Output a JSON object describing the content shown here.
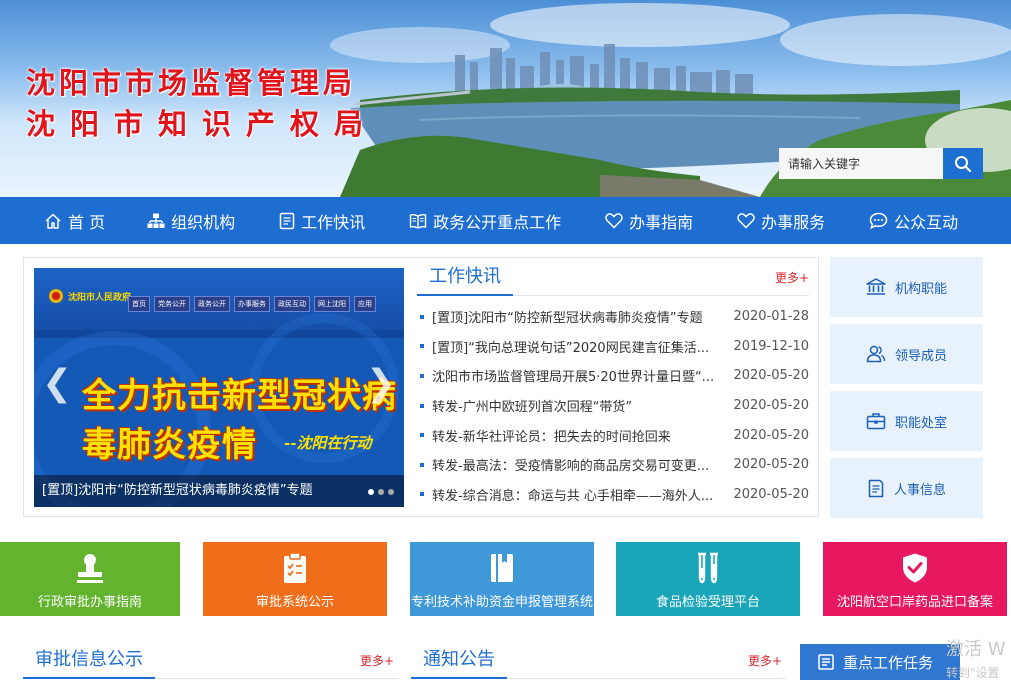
{
  "banner": {
    "title_line1": "沈阳市市场监督管理局",
    "title_line2": "沈阳市知识产权局",
    "search_placeholder": "请输入关键字",
    "search_icon": "magnifier-icon"
  },
  "nav": {
    "items": [
      {
        "label": "首 页",
        "icon": "home-icon"
      },
      {
        "label": "组织机构",
        "icon": "org-chart-icon"
      },
      {
        "label": "工作快讯",
        "icon": "document-icon"
      },
      {
        "label": "政务公开重点工作",
        "icon": "book-icon"
      },
      {
        "label": "办事指南",
        "icon": "heart-icon"
      },
      {
        "label": "办事服务",
        "icon": "heart-icon"
      },
      {
        "label": "公众互动",
        "icon": "chat-icon"
      }
    ]
  },
  "slider": {
    "logo_text": "沈阳市人民政府",
    "menu": [
      "首页",
      "党务公开",
      "政务公开",
      "办事服务",
      "政民互动",
      "网上沈阳",
      "应用"
    ],
    "headline": "全力抗击新型冠状病毒肺炎疫情",
    "sub": "--沈阳在行动",
    "caption": "[置顶]沈阳市“防控新型冠状病毒肺炎疫情”专题",
    "prev": "❮",
    "next": "❯"
  },
  "news": {
    "title": "工作快讯",
    "more": "更多+",
    "items": [
      {
        "title": "[置顶]沈阳市“防控新型冠状病毒肺炎疫情”专题",
        "date": "2020-01-28"
      },
      {
        "title": "[置顶]“我向总理说句话”2020网民建言征集活...",
        "date": "2019-12-10"
      },
      {
        "title": "沈阳市市场监督管理局开展5·20世界计量日暨“...",
        "date": "2020-05-20"
      },
      {
        "title": "转发-广州中欧班列首次回程“带货”",
        "date": "2020-05-20"
      },
      {
        "title": "转发-新华社评论员：把失去的时间抢回来",
        "date": "2020-05-20"
      },
      {
        "title": "转发-最高法：受疫情影响的商品房交易可变更...",
        "date": "2020-05-20"
      },
      {
        "title": "转发-综合消息：命运与共 心手相牵——海外人...",
        "date": "2020-05-20"
      }
    ]
  },
  "quick": [
    {
      "label": "机构职能",
      "icon": "institution-icon"
    },
    {
      "label": "领导成员",
      "icon": "users-icon"
    },
    {
      "label": "职能处室",
      "icon": "briefcase-icon"
    },
    {
      "label": "人事信息",
      "icon": "notepad-icon"
    }
  ],
  "tiles": [
    {
      "label": "行政审批办事指南",
      "icon": "stamp-icon",
      "color": "#63b32e"
    },
    {
      "label": "审批系统公示",
      "icon": "clipboard-icon",
      "color": "#f06e1a"
    },
    {
      "label": "专利技术补助资金申报管理系统",
      "icon": "book-icon",
      "color": "#3f98d8"
    },
    {
      "label": "食品检验受理平台",
      "icon": "test-tube-icon",
      "color": "#1aa6b8"
    },
    {
      "label": "沈阳航空口岸药品进口备案",
      "icon": "shield-check-icon",
      "color": "#e7185f"
    }
  ],
  "bottom": {
    "approval_title": "审批信息公示",
    "approval_more": "更多+",
    "notice_title": "通知公告",
    "notice_more": "更多+",
    "keywork_label": "重点工作任务",
    "watermark_line1": "激活 W",
    "watermark_line2": "转到\"设置"
  }
}
